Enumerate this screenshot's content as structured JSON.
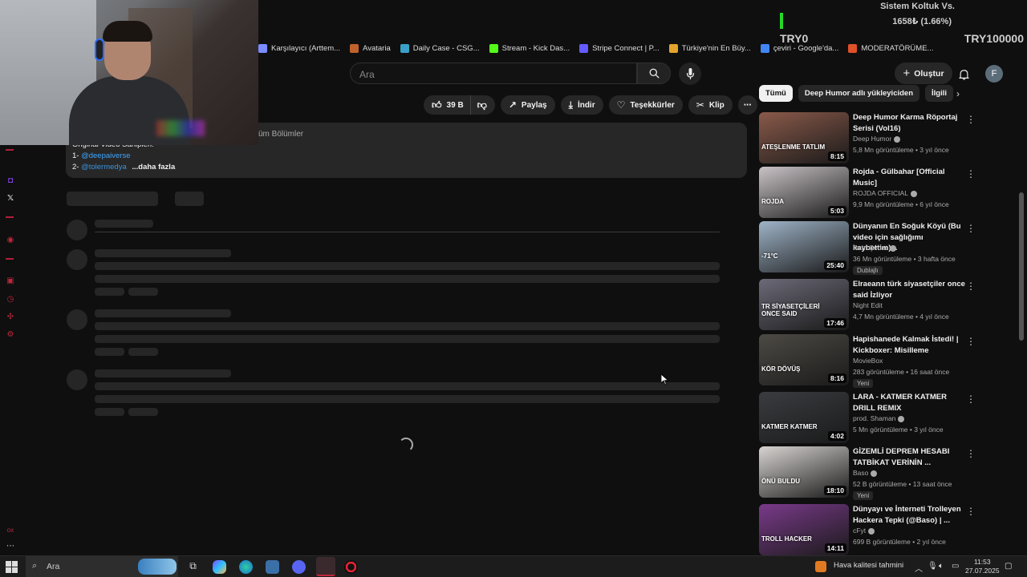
{
  "overlay": {
    "stats_title": "Sistem Koltuk Vs.",
    "stats_value": "1658₺ (1.66%)",
    "goal_start": "TRY0",
    "goal_end": "TRY100000",
    "goal_progress_percent": 1.66
  },
  "bookmarks": [
    {
      "label": "Karşılayıcı (Arttem...",
      "color": "#7a8cff"
    },
    {
      "label": "Avataria",
      "color": "#c0622d"
    },
    {
      "label": "Daily Case - CSG...",
      "color": "#3aa0c8"
    },
    {
      "label": "Stream - Kick Das...",
      "color": "#53fc18"
    },
    {
      "label": "Stripe Connect | P...",
      "color": "#635bff"
    },
    {
      "label": "Türkiye'nin En Büy...",
      "color": "#e3a32b"
    },
    {
      "label": "çeviri - Google'da...",
      "color": "#4285f4"
    },
    {
      "label": "MODERATÖRÜME...",
      "color": "#e0502a"
    }
  ],
  "header": {
    "search_placeholder": "Ara",
    "create_label": "Oluştur",
    "avatar_letter": "F"
  },
  "actions": {
    "like_count": "39 B",
    "share": "Paylaş",
    "download": "İndir",
    "thanks": "Teşekkürler",
    "clip": "Klip"
  },
  "description": {
    "line0": "Original Video Sahipleri:",
    "line1_prefix": "1-",
    "line1_link": "@deepaiverse",
    "line2_prefix": "2-",
    "line2_link": "@tolermedya",
    "more": "...daha fazla",
    "chapters": "üm Bölümler"
  },
  "sidebar": {
    "chips": [
      "Tümü",
      "Deep Humor adlı yükleyiciden",
      "İlgili"
    ],
    "videos": [
      {
        "title": "Deep Humor Karma Röportaj Serisi (Vol16)",
        "channel": "Deep Humor",
        "verified": true,
        "meta": "5,8 Mn görüntüleme • 3 yıl önce",
        "duration": "8:15",
        "badge": "",
        "thumb_color": "#8a5a4a",
        "thumb_text": "ATEŞLENME TATLIM"
      },
      {
        "title": "Rojda - Gülbahar [Official Music]",
        "channel": "ROJDA OFFICIAL",
        "verified": true,
        "meta": "9,9 Mn görüntüleme • 6 yıl önce",
        "duration": "5:03",
        "badge": "",
        "thumb_color": "#c9c3c6",
        "thumb_text": "ROJDA"
      },
      {
        "title": "Dünyanın En Soğuk Köyü (Bu video için sağlığımı kaybettim)...",
        "channel": "Ruhi Çenet",
        "verified": true,
        "meta": "36 Mn görüntüleme • 3 hafta önce",
        "duration": "25:40",
        "badge": "Dublajlı",
        "thumb_color": "#9fb4c8",
        "thumb_text": "-71°C"
      },
      {
        "title": "Elraeann türk siyasetçiler once said İzliyor",
        "channel": "Night Edit",
        "verified": false,
        "meta": "4,7 Mn görüntüleme • 4 yıl önce",
        "duration": "17:46",
        "badge": "",
        "thumb_color": "#6c6a78",
        "thumb_text": "TR SİYASETÇİLERİ ONCE SAID"
      },
      {
        "title": "Hapishanede Kalmak İstedi! | Kickboxer: Misilleme",
        "channel": "MovieBox",
        "verified": false,
        "meta": "283 görüntüleme • 16 saat önce",
        "duration": "8:16",
        "badge": "Yeni",
        "thumb_color": "#4d4a44",
        "thumb_text": "KÖR DÖVÜŞ"
      },
      {
        "title": "LARA - KATMER KATMER DRILL REMIX",
        "channel": "prod. Shaman",
        "verified": true,
        "meta": "5 Mn görüntüleme • 3 yıl önce",
        "duration": "4:02",
        "badge": "",
        "thumb_color": "#3a3c40",
        "thumb_text": "KATMER KATMER"
      },
      {
        "title": "GİZEMLİ DEPREM HESABI TATBİKAT VERİNİN ...",
        "channel": "Baso",
        "verified": true,
        "meta": "52 B görüntüleme • 13 saat önce",
        "duration": "18:10",
        "badge": "Yeni",
        "thumb_color": "#d8d4d2",
        "thumb_text": "ÖNÜ BULDU"
      },
      {
        "title": "Dünyayı ve İnterneti Trolleyen Hackera Tepki (@Baso) | ...",
        "channel": "cFyt",
        "verified": true,
        "meta": "699 B görüntüleme • 2 yıl önce",
        "duration": "14:11",
        "badge": "",
        "thumb_color": "#7a3a8a",
        "thumb_text": "TROLL HACKER"
      }
    ]
  },
  "taskbar": {
    "search_label": "Ara",
    "weather": "Hava kalitesi tahmini",
    "time": "11:53",
    "date": "27.07.2025"
  }
}
